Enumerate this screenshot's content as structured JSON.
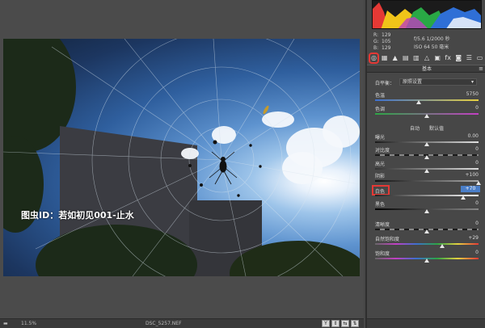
{
  "photo": {
    "watermark": "图虫ID：若如初见001-止水"
  },
  "statusbar": {
    "zoom": "11.5%",
    "filename": "DSC_5257.NEF",
    "buttons": [
      "Y",
      "⇕",
      "⇆",
      "⇅"
    ]
  },
  "camera_info": {
    "r_label": "R:",
    "g_label": "G:",
    "b_label": "B:",
    "aperture_shutter": "f/5.6  1/2000 秒",
    "iso_focal": "ISO 64   50 毫米",
    "r_val": "129",
    "g_val": "105",
    "b_val": "129"
  },
  "tool_tabs": [
    {
      "icon": "aperture-icon",
      "glyph": "◎"
    },
    {
      "icon": "grid-icon",
      "glyph": "▦"
    },
    {
      "icon": "mountain-icon",
      "glyph": "▲"
    },
    {
      "icon": "hsl-icon",
      "glyph": "▤"
    },
    {
      "icon": "split-tone-icon",
      "glyph": "▥"
    },
    {
      "icon": "detail-icon",
      "glyph": "△"
    },
    {
      "icon": "lens-icon",
      "glyph": "▣"
    },
    {
      "icon": "fx-icon",
      "glyph": "fx"
    },
    {
      "icon": "camera-icon",
      "glyph": "◙"
    },
    {
      "icon": "presets-icon",
      "glyph": "☰"
    },
    {
      "icon": "snapshot-icon",
      "glyph": "▭"
    }
  ],
  "section": {
    "title": "基本"
  },
  "white_balance": {
    "label": "白平衡：",
    "value": "原照设置"
  },
  "sliders": {
    "temp": {
      "label": "色温",
      "value": "5750",
      "pos": 0.42
    },
    "tint": {
      "label": "色调",
      "value": "0",
      "pos": 0.5
    },
    "exposure": {
      "label": "曝光",
      "value": "0.00",
      "pos": 0.5
    },
    "contrast": {
      "label": "对比度",
      "value": "0",
      "pos": 0.5
    },
    "highlights": {
      "label": "高光",
      "value": "0",
      "pos": 0.5
    },
    "shadows": {
      "label": "阴影",
      "value": "+100",
      "pos": 1.0
    },
    "whites": {
      "label": "白色",
      "value": "+70",
      "pos": 0.85
    },
    "blacks": {
      "label": "黑色",
      "value": "0",
      "pos": 0.5
    },
    "clarity": {
      "label": "清晰度",
      "value": "0",
      "pos": 0.5
    },
    "vibrance": {
      "label": "自然饱和度",
      "value": "+29",
      "pos": 0.645
    },
    "saturation": {
      "label": "饱和度",
      "value": "0",
      "pos": 0.5
    }
  },
  "auto_links": {
    "auto": "自动",
    "default": "默认值"
  },
  "colors": {
    "highlight": "#e53935",
    "selected_value": "#4a7ec8"
  }
}
